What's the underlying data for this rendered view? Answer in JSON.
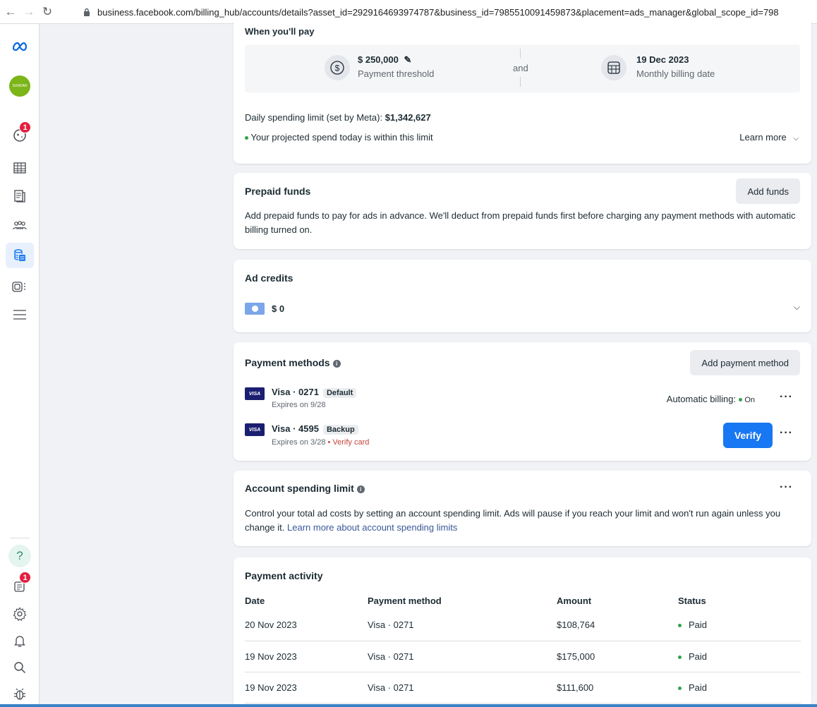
{
  "browser": {
    "url": "business.facebook.com/billing_hub/accounts/details?asset_id=2929164693974787&business_id=7985510091459873&placement=ads_manager&global_scope_id=798"
  },
  "rail": {
    "account_logo_text": "SUNDAR",
    "notification_badge": "1",
    "inbox_badge": "1",
    "help_label": "?"
  },
  "when_you_pay": {
    "title": "When you'll pay",
    "threshold_value": "$ 250,000",
    "threshold_label": "Payment threshold",
    "and_label": "and",
    "billing_date_value": "19 Dec 2023",
    "billing_date_label": "Monthly billing date",
    "daily_limit_label": "Daily spending limit (set by Meta): ",
    "daily_limit_value": "$1,342,627",
    "projected_text": "Your projected spend today is within this limit",
    "learn_more": "Learn more"
  },
  "prepaid": {
    "title": "Prepaid funds",
    "button": "Add funds",
    "description": "Add prepaid funds to pay for ads in advance. We'll deduct from prepaid funds first before charging any payment methods with automatic billing turned on."
  },
  "ad_credits": {
    "title": "Ad credits",
    "amount": "$ 0"
  },
  "payment_methods": {
    "title": "Payment methods",
    "button": "Add payment method",
    "cards": [
      {
        "brand": "VISA",
        "name": "Visa · 0271",
        "tag": "Default",
        "expiry": "Expires on 9/28",
        "warning": "",
        "billing_label": "Automatic billing:",
        "billing_status": "On"
      },
      {
        "brand": "VISA",
        "name": "Visa · 4595",
        "tag": "Backup",
        "expiry": "Expires on 3/28",
        "warning": " • Verify card",
        "verify_button": "Verify"
      }
    ]
  },
  "spending_limit": {
    "title": "Account spending limit",
    "description": "Control your total ad costs by setting an account spending limit. Ads will pause if you reach your limit and won't run again unless you change it. ",
    "link": "Learn more about account spending limits"
  },
  "activity": {
    "title": "Payment activity",
    "columns": [
      "Date",
      "Payment method",
      "Amount",
      "Status"
    ],
    "rows": [
      {
        "date": "20 Nov 2023",
        "method": "Visa · 0271",
        "amount": "$108,764",
        "status": "Paid"
      },
      {
        "date": "19 Nov 2023",
        "method": "Visa · 0271",
        "amount": "$175,000",
        "status": "Paid"
      },
      {
        "date": "19 Nov 2023",
        "method": "Visa · 0271",
        "amount": "$111,600",
        "status": "Paid"
      }
    ]
  },
  "colors": {
    "accent": "#1877f2",
    "success": "#31a24c",
    "danger": "#e41e3f",
    "warning_text": "#c4443a"
  }
}
